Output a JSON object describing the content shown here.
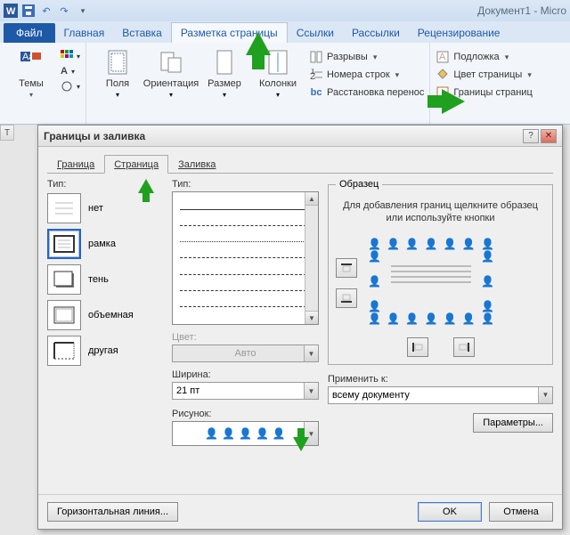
{
  "titlebar": {
    "doc_title": "Документ1 - Micro"
  },
  "qa": {
    "save": "save",
    "undo": "undo",
    "redo": "redo"
  },
  "tabs": {
    "file": "Файл",
    "home": "Главная",
    "insert": "Вставка",
    "layout": "Разметка страницы",
    "references": "Ссылки",
    "mailings": "Рассылки",
    "review": "Рецензирование"
  },
  "ribbon": {
    "themes": "Темы",
    "margins": "Поля",
    "orientation": "Ориентация",
    "size": "Размер",
    "columns": "Колонки",
    "breaks": "Разрывы",
    "line_numbers": "Номера строк",
    "hyphenation": "Расстановка перенос",
    "watermark": "Подложка",
    "page_color": "Цвет страницы",
    "page_borders": "Границы страниц"
  },
  "dialog": {
    "title": "Границы и заливка",
    "tabs": {
      "border": "Граница",
      "page": "Страница",
      "fill": "Заливка"
    },
    "type_label": "Тип:",
    "types": {
      "none": "нет",
      "box": "рамка",
      "shadow": "тень",
      "threeD": "объемная",
      "custom": "другая"
    },
    "style_label": "Тип:",
    "color_label": "Цвет:",
    "color_value": "Авто",
    "width_label": "Ширина:",
    "width_value": "21 пт",
    "art_label": "Рисунок:",
    "preview_legend": "Образец",
    "preview_hint": "Для добавления границ щелкните образец или используйте кнопки",
    "apply_label": "Применить к:",
    "apply_value": "всему документу",
    "params_btn": "Параметры...",
    "hline_btn": "Горизонтальная линия...",
    "ok": "OK",
    "cancel": "Отмена"
  },
  "left_marker": "Т"
}
